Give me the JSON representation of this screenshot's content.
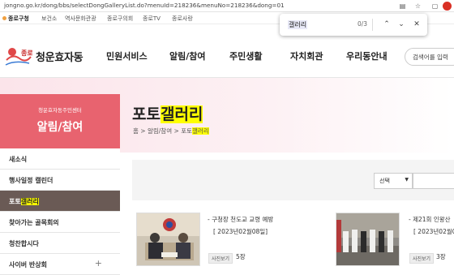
{
  "browser": {
    "url": "jongno.go.kr/dong/bbs/selectDongGalleryList.do?menuId=218236&menuNo=218236&dong=01"
  },
  "bookmarks": [
    "종로구청",
    "보건소",
    "역사문화관광",
    "종로구의회",
    "종로TV",
    "종로사랑"
  ],
  "findbar": {
    "query": "갤러리",
    "count": "0/3"
  },
  "header": {
    "logo_text": "청운효자동",
    "emblem_text": "종로",
    "nav": [
      "민원서비스",
      "알림/참여",
      "주민생활",
      "자치회관",
      "우리동안내"
    ],
    "search_placeholder": "검색어를 입력"
  },
  "left_title": {
    "subtitle": "청운효자동주민센터",
    "title": "알림/참여"
  },
  "page": {
    "title_prefix": "포토",
    "title_highlight": "갤러리",
    "breadcrumb": {
      "home": "홈",
      "sep1": ">",
      "section": "알림/참여",
      "sep2": ">",
      "current_prefix": "포토",
      "current_highlight": "갤러리"
    }
  },
  "side_menu": [
    {
      "prefix": "새소식",
      "highlight": "",
      "active": false,
      "plus": ""
    },
    {
      "prefix": "행사일정 캘린더",
      "highlight": "",
      "active": false,
      "plus": ""
    },
    {
      "prefix": "포토",
      "highlight": "갤러리",
      "active": true,
      "plus": ""
    },
    {
      "prefix": "찾아가는 골목회의",
      "highlight": "",
      "active": false,
      "plus": ""
    },
    {
      "prefix": "청찬합시다",
      "highlight": "",
      "active": false,
      "plus": ""
    },
    {
      "prefix": "사이버 반상회",
      "highlight": "",
      "active": false,
      "plus": "+"
    }
  ],
  "filter": {
    "select_label": "선택"
  },
  "gallery": [
    {
      "title": "구청장 천도교 교령 예방",
      "date": "[ 2023년02월08일]",
      "badge": "사진보기",
      "count": "5장"
    },
    {
      "title": "제21회 인왕산",
      "date": "[ 2023년02월0",
      "badge": "사진보기",
      "count": "3장"
    }
  ]
}
